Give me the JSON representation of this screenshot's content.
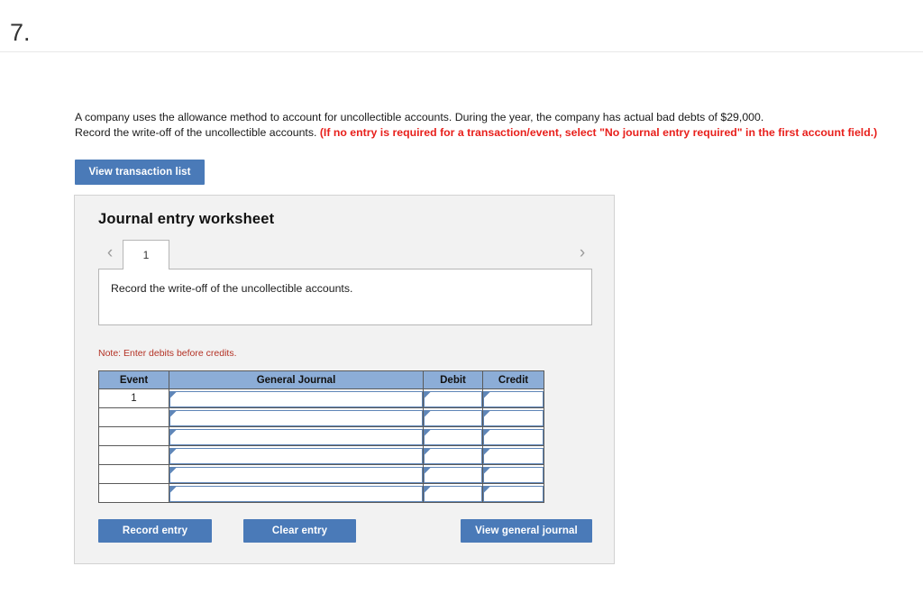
{
  "header": {
    "question_number": "7."
  },
  "prompt": {
    "line_1": "A company uses the allowance method to account for uncollectible accounts. During the year, the company has actual bad debts of $29,000.",
    "line_2_plain": "Record the write-off of the uncollectible accounts. ",
    "line_2_emphasis": "(If no entry is required for a transaction/event, select \"No journal entry required\" in the first account field.)"
  },
  "actions": {
    "view_transaction_list": "View transaction list",
    "record_entry": "Record entry",
    "clear_entry": "Clear entry",
    "view_general_journal": "View general journal"
  },
  "worksheet": {
    "title": "Journal entry worksheet",
    "prev_arrow": "‹",
    "next_arrow": "›",
    "tabs": [
      {
        "label": "1",
        "selected": true
      }
    ],
    "transaction_description": "Record the write-off of the uncollectible accounts.",
    "note": "Note: Enter debits before credits."
  },
  "journal_table": {
    "columns": [
      "Event",
      "General Journal",
      "Debit",
      "Credit"
    ],
    "rows": [
      {
        "event": "1",
        "general_journal": "",
        "debit": "",
        "credit": ""
      },
      {
        "event": "",
        "general_journal": "",
        "debit": "",
        "credit": ""
      },
      {
        "event": "",
        "general_journal": "",
        "debit": "",
        "credit": ""
      },
      {
        "event": "",
        "general_journal": "",
        "debit": "",
        "credit": ""
      },
      {
        "event": "",
        "general_journal": "",
        "debit": "",
        "credit": ""
      },
      {
        "event": "",
        "general_journal": "",
        "debit": "",
        "credit": ""
      }
    ]
  },
  "colors": {
    "button_blue": "#4a7ab8",
    "table_header_blue": "#8cadd7",
    "note_red": "#b43225",
    "emphasis_red": "#e8201c",
    "panel_gray": "#f2f2f2"
  }
}
